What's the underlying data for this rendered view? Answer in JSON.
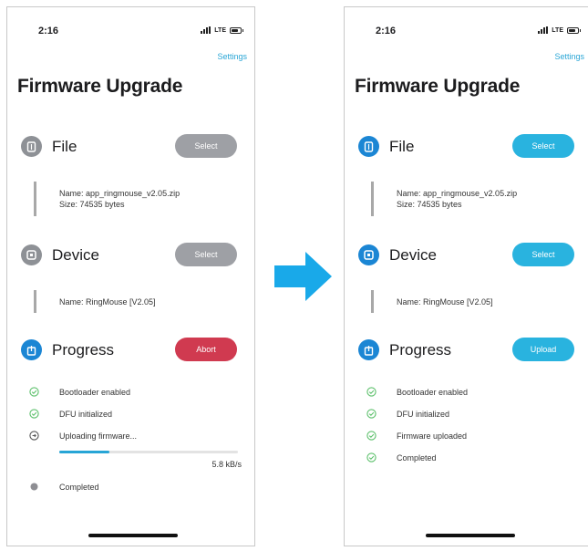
{
  "colors": {
    "accent": "#29b3df",
    "abort": "#d03a50",
    "disabled": "#9ea0a5",
    "success": "#5cc06b",
    "link": "#2aa6d6"
  },
  "arrow_icon": "right-arrow-icon",
  "left": {
    "status_time": "2:16",
    "network": "LTE",
    "settings": "Settings",
    "title": "Firmware Upgrade",
    "file": {
      "label": "File",
      "button": "Select",
      "name": "Name: app_ringmouse_v2.05.zip",
      "size": "Size: 74535 bytes"
    },
    "device": {
      "label": "Device",
      "button": "Select",
      "name": "Name: RingMouse [V2.05]"
    },
    "progress": {
      "label": "Progress",
      "button": "Abort",
      "steps": [
        "Bootloader enabled",
        "DFU initialized",
        "Uploading firmware...",
        "Completed"
      ],
      "upload_progress": 0.28,
      "speed": "5.8 kB/s"
    }
  },
  "right": {
    "status_time": "2:16",
    "network": "LTE",
    "settings": "Settings",
    "title": "Firmware Upgrade",
    "file": {
      "label": "File",
      "button": "Select",
      "name": "Name: app_ringmouse_v2.05.zip",
      "size": "Size: 74535 bytes"
    },
    "device": {
      "label": "Device",
      "button": "Select",
      "name": "Name: RingMouse [V2.05]"
    },
    "progress": {
      "label": "Progress",
      "button": "Upload",
      "steps": [
        "Bootloader enabled",
        "DFU initialized",
        "Firmware uploaded",
        "Completed"
      ]
    }
  }
}
